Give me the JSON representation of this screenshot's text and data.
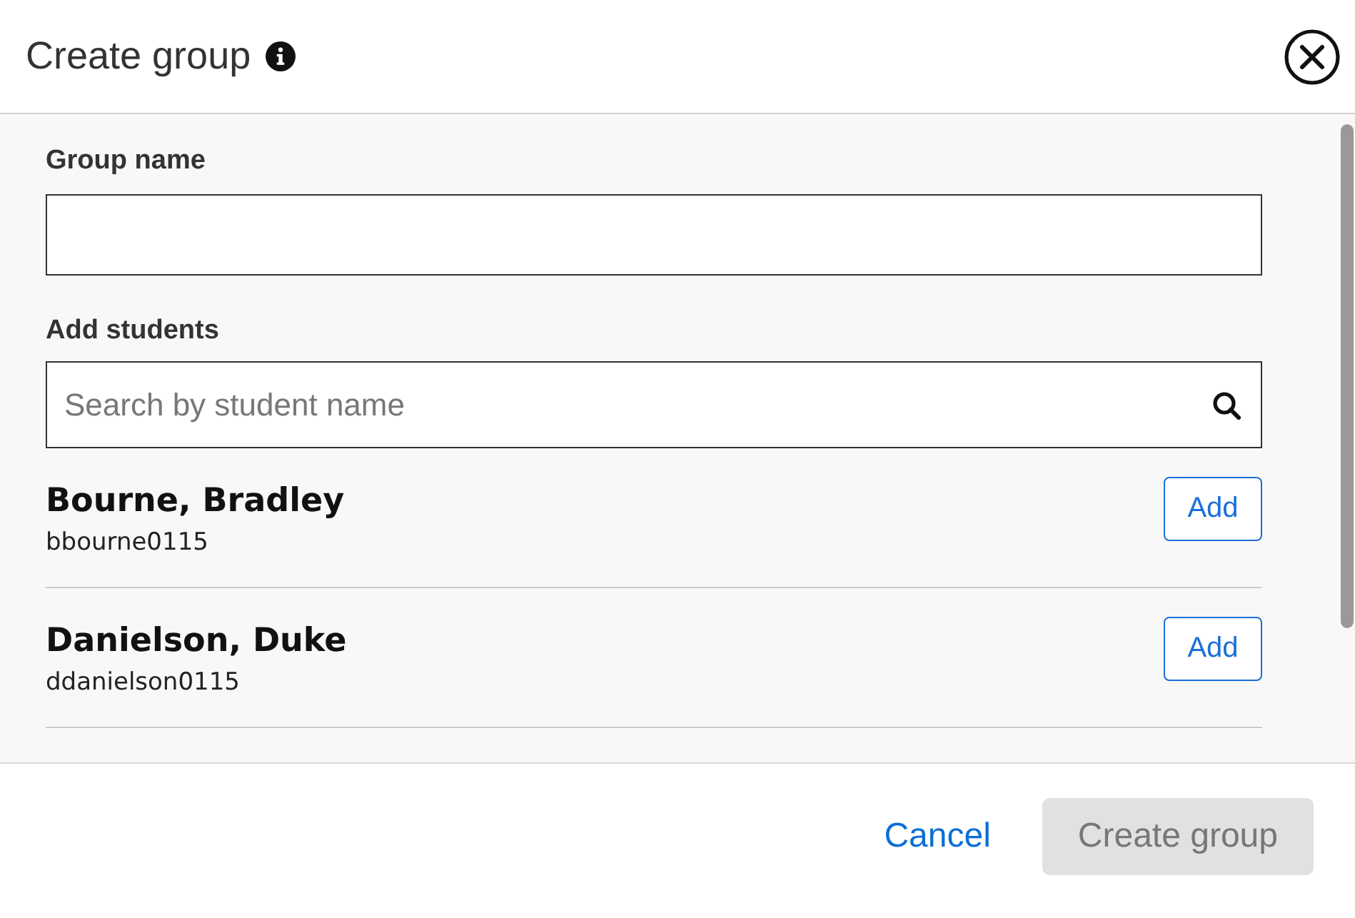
{
  "dialog": {
    "title": "Create group"
  },
  "form": {
    "group_name": {
      "label": "Group name"
    },
    "add_students": {
      "label": "Add students",
      "placeholder": "Search by student name"
    }
  },
  "students": [
    {
      "name": "Bourne, Bradley",
      "username": "bbourne0115",
      "action": "Add"
    },
    {
      "name": "Danielson, Duke",
      "username": "ddanielson0115",
      "action": "Add"
    }
  ],
  "footer": {
    "cancel": "Cancel",
    "submit": {
      "label": "Create group",
      "disabled": true
    }
  }
}
